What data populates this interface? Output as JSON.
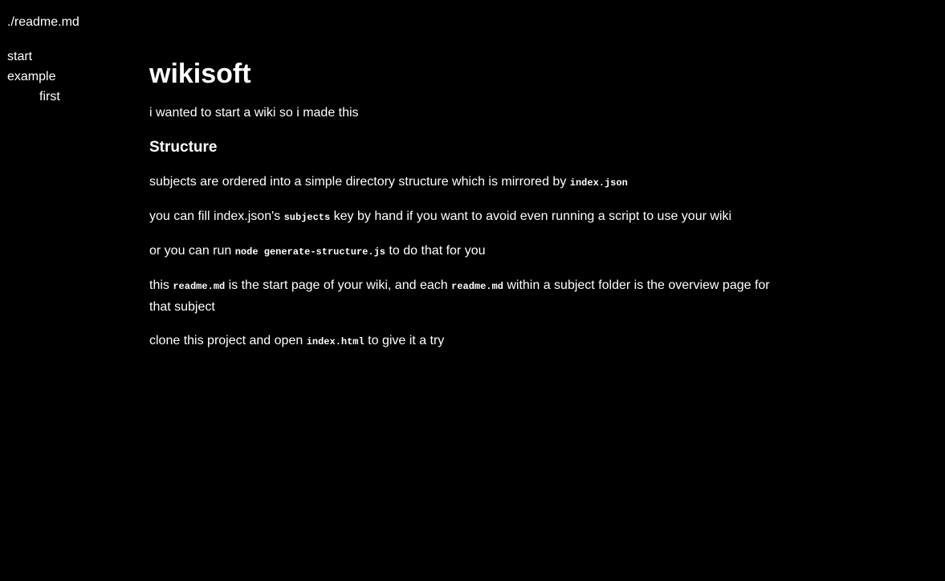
{
  "header": {
    "path": "./readme.md"
  },
  "sidebar": {
    "items": [
      {
        "label": "start"
      },
      {
        "label": "example"
      },
      {
        "label": "first"
      }
    ]
  },
  "main": {
    "title": "wikisoft",
    "intro": "i wanted to start a wiki so i made this",
    "section_title": "Structure",
    "p1": {
      "text": "subjects are ordered into a simple directory structure which is mirrored by ",
      "code": "index.json"
    },
    "p2": {
      "before": "you can fill index.json's ",
      "code": "subjects",
      "after": " key by hand if you want to avoid even running a script to use your wiki"
    },
    "p3": {
      "before": "or you can run ",
      "code": "node generate-structure.js",
      "after": " to do that for you"
    },
    "p4": {
      "before": "this ",
      "code1": "readme.md",
      "middle": " is the start page of your wiki, and each ",
      "code2": "readme.md",
      "after": " within a subject folder is the overview page for that subject"
    },
    "p5": {
      "before": "clone this project and open ",
      "code": "index.html",
      "after": " to give it a try"
    }
  }
}
